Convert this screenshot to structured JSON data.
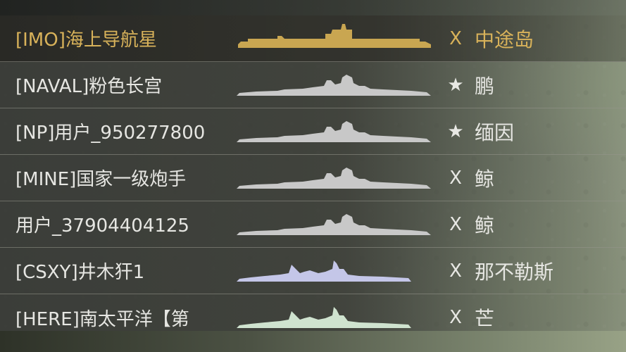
{
  "players": [
    {
      "name": "[IMO]海上导航星",
      "marker": "X",
      "map": "中途岛",
      "ship_type": "carrier",
      "ship_color": "#c9a651",
      "selected": true
    },
    {
      "name": "[NAVAL]粉色长宫",
      "marker": "★",
      "map": "鹏",
      "ship_type": "battleship",
      "ship_color": "#c8c8c8",
      "selected": false
    },
    {
      "name": "[NP]用户_950277800",
      "marker": "★",
      "map": "缅因",
      "ship_type": "battleship",
      "ship_color": "#c8c8c8",
      "selected": false
    },
    {
      "name": "[MINE]国家一级炮手",
      "marker": "X",
      "map": "鲸",
      "ship_type": "battleship",
      "ship_color": "#c8c8c8",
      "selected": false
    },
    {
      "name": "用户_37904404125",
      "marker": "X",
      "map": "鲸",
      "ship_type": "battleship",
      "ship_color": "#c8c8c8",
      "selected": false
    },
    {
      "name": "[CSXY]井木犴1",
      "marker": "X",
      "map": "那不勒斯",
      "ship_type": "cruiser",
      "ship_color": "#c4c6e8",
      "selected": false
    },
    {
      "name": "[HERE]南太平洋【第",
      "marker": "X",
      "map": "芒",
      "ship_type": "cruiser",
      "ship_color": "#cfe3cf",
      "selected": false
    }
  ]
}
